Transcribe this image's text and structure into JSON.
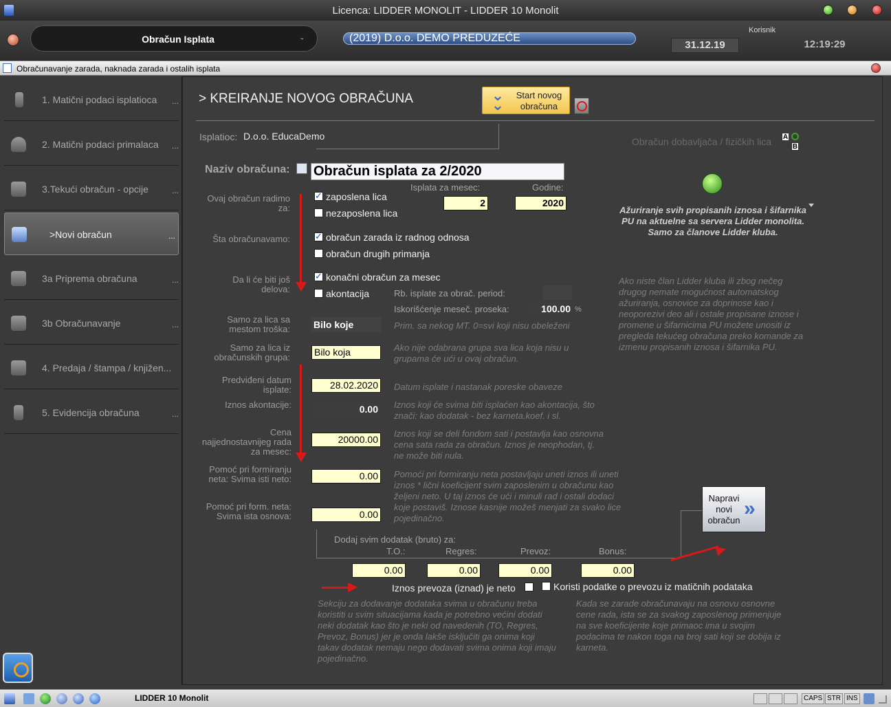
{
  "window": {
    "title": "Licenca: LIDDER MONOLIT - LIDDER 10 Monolit"
  },
  "header": {
    "module": "Obračun Isplata",
    "module_dash": "-",
    "company": "(2019) D.o.o. DEMO PREDUZEĆE",
    "user_label": "Korisnik",
    "date": "31.12.19",
    "time": "12:19:29"
  },
  "inner_window": {
    "title": "Obračunavanje zarada, naknada zarada i ostalih isplata"
  },
  "sidebar": {
    "items": [
      {
        "label": "1. Matični podaci isplatioca",
        "dots": "..."
      },
      {
        "label": "2. Matični podaci primalaca",
        "dots": "..."
      },
      {
        "label": "3.Tekući obračun - opcije",
        "dots": "..."
      },
      {
        "label": ">Novi obračun",
        "dots": "..."
      },
      {
        "label": "3a Priprema obračuna",
        "dots": "..."
      },
      {
        "label": "3b Obračunavanje",
        "dots": "..."
      },
      {
        "label": "4. Predaja / štampa / knjižen...",
        "dots": ""
      },
      {
        "label": "5. Evidencija obračuna",
        "dots": "..."
      }
    ]
  },
  "form": {
    "heading": "> KREIRANJE NOVOG OBRAČUNA",
    "start_button": "Start novog obračuna",
    "payer_label": "Isplatioc:",
    "payer_value": "D.o.o. EducaDemo",
    "contractor_label": "Obračun dobavljača / fizičkih lica",
    "name_label": "Naziv obračuna:",
    "name_value": "Obračun isplata za 2/2020",
    "for_label": "Ovaj obračun radimo za:",
    "employed": "zaposlena lica",
    "unemployed": "nezaposlena lica",
    "month_label": "Isplata za mesec:",
    "month_value": "2",
    "year_label": "Godine:",
    "year_value": "2020",
    "what_label": "Šta obračunavamo:",
    "salary": "obračun zarada iz radnog odnosa",
    "other": "obračun drugih primanja",
    "parts_label": "Da li će biti još delova:",
    "final": "konačni obračun za mesec",
    "advance": "akontacija",
    "rb_label": "Rb. isplate za obrač. period:",
    "usage_label": "Iskorišćenje meseč. proseka:",
    "usage_value": "100.00",
    "usage_unit": "%",
    "cost_label": "Samo za lica sa mestom troška:",
    "cost_value": "Bilo koje",
    "cost_hint": "Prim. sa nekog MT. 0=svi koji nisu obeleženi",
    "group_label": "Samo za lica iz obračunskih grupa:",
    "group_value": "Bilo koja",
    "group_hint": "Ako nije odabrana grupa sva lica koja nisu u grupama će ući u ovaj obračun.",
    "date_label": "Predviđeni datum isplate:",
    "date_value": "28.02.2020",
    "date_hint": "Datum isplate i nastanak poreske obaveze",
    "adv_label": "Iznos akontacije:",
    "adv_value": "0.00",
    "adv_hint": "Iznos koji će svima biti isplaćen kao akontacija, što znači: kao dodatak - bez karneta.koef. i sl.",
    "price_label": "Cena najjednostavnijeg rada za mesec:",
    "price_value": "20000.00",
    "price_hint": "Iznos koji se deli fondom sati i postavlja kao osnovna cena sata rada za obračun. Iznos je neophodan, tj. ne može biti nula.",
    "net_label": "Pomoć pri formiranju neta: Svima isti neto:",
    "net_value": "0.00",
    "net_hint": "Pomoći pri formiranju neta postavljaju uneti iznos ili uneti iznos * lični koeficijent svim zaposlenim u obračunu kao željeni neto. U taj iznos će ući i minuli rad i ostali dodaci koje postaviš. Iznose kasnije možeš menjati za svako lice pojedinačno.",
    "base_label": "Pomoć pri form. neta: Svima ista osnova:",
    "base_value": "0.00",
    "add_label": "Dodaj svim dodatak (bruto) za:",
    "to_label": "T.O.:",
    "regres_label": "Regres:",
    "prevoz_label": "Prevoz:",
    "bonus_label": "Bonus:",
    "to_value": "0.00",
    "regres_value": "0.00",
    "prevoz_value": "0.00",
    "bonus_value": "0.00",
    "transport_net": "Iznos prevoza (iznad) je neto",
    "transport_master": "Koristi podatke o prevozu iz matičnih podataka",
    "create_button": "Napravi novi obračun",
    "update_text": "Ažuriranje svih propisanih iznosa i šifarnika PU na aktuelne sa servera Lidder monolita. Samo za članove Lidder kluba.",
    "update_hint": "Ako niste član Lidder kluba ili zbog nečeg drugog nemate mogućnost automatskog ažuriranja, osnovice za doprinose kao i neoporezivi deo ali i ostale propisane iznose i promene u šifarnicima PU možete unositi iz pregleda tekućeg obračuna preko komande za izmenu propisanih iznosa i šifarnika PU.",
    "section_hint": "Sekciju za dodavanje dodataka svima u obračunu treba koristiti u svim situacijama kada je potrebno većini dodati neki dodatak kao što je neki od navedenih (TO, Regres, Prevoz, Bonus) jer je onda lakše isključiti ga onima koji takav dodatak nemaju nego dodavati svima onima koji imaju pojedinačno.",
    "coef_hint": "Kada se zarade obračunavaju na osnovu osnovne cene rada, ista se za svakog zaposlenog primenjuje na sve koeficijente koje primaoc ima u svojim podacima te nakon toga na broj sati koji se dobija iz karneta."
  },
  "taskbar": {
    "app": "LIDDER 10 Monolit",
    "caps": "CAPS",
    "str": "STR",
    "ins": "INS"
  }
}
